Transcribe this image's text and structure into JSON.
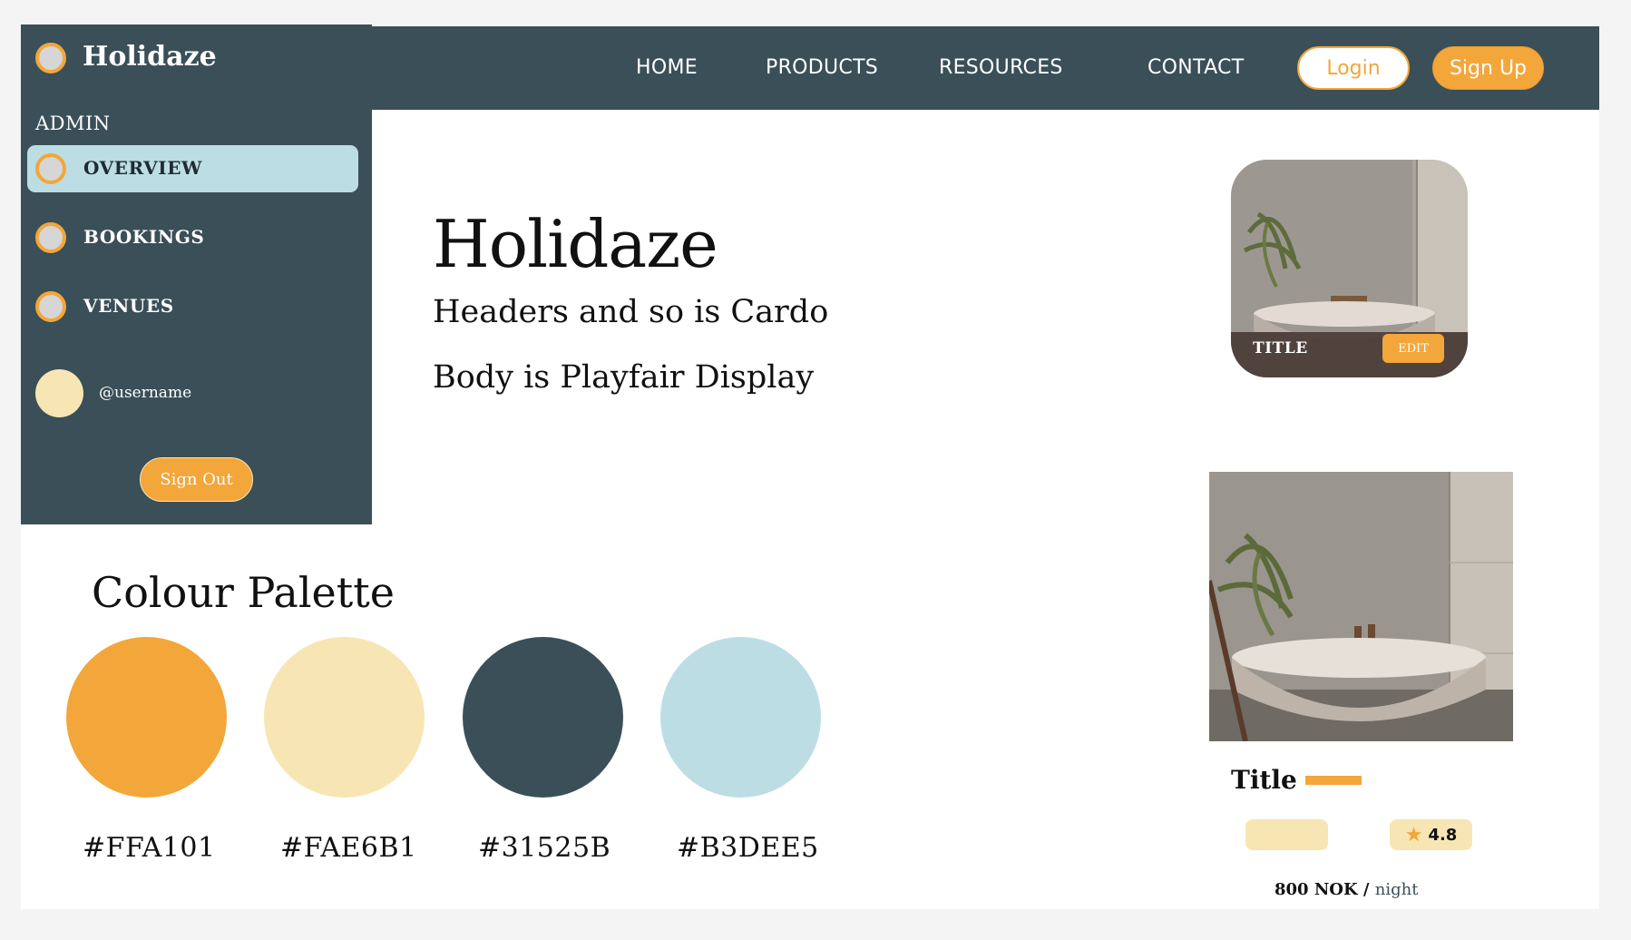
{
  "nav": {
    "links": [
      "HOME",
      "PRODUCTS",
      "RESOURCES",
      "CONTACT"
    ],
    "login_label": "Login",
    "signup_label": "Sign Up"
  },
  "sidebar": {
    "brand": "Holidaze",
    "section_label": "ADMIN",
    "items": [
      {
        "label": "OVERVIEW",
        "active": true
      },
      {
        "label": "BOOKINGS",
        "active": false
      },
      {
        "label": "VENUES",
        "active": false
      }
    ],
    "username": "@username",
    "signout_label": "Sign Out"
  },
  "hero": {
    "title": "Holidaze",
    "line1": "Headers and so is Cardo",
    "line2": "Body is Playfair Display"
  },
  "palette": {
    "title": "Colour Palette",
    "swatches": [
      {
        "hex": "#F3A63A",
        "label": "#FFA101"
      },
      {
        "hex": "#F7E6B3",
        "label": "#FAE6B1"
      },
      {
        "hex": "#3A4F58",
        "label": "#31525B"
      },
      {
        "hex": "#BCDDE4",
        "label": "#B3DEE5"
      }
    ]
  },
  "card_small": {
    "title": "TITLE",
    "edit_label": "EDIT",
    "image_icon": "bathtub-photo"
  },
  "card_large": {
    "title": "Title",
    "rating": "4.8",
    "rating_icon": "star-icon",
    "price": "800 NOK /",
    "unit": "night",
    "image_icon": "bathtub-photo"
  },
  "colors": {
    "primary_dark": "#3A4F58",
    "accent_orange": "#F3A63A",
    "cream": "#F7E6B3",
    "light_blue": "#BCDDE4"
  }
}
